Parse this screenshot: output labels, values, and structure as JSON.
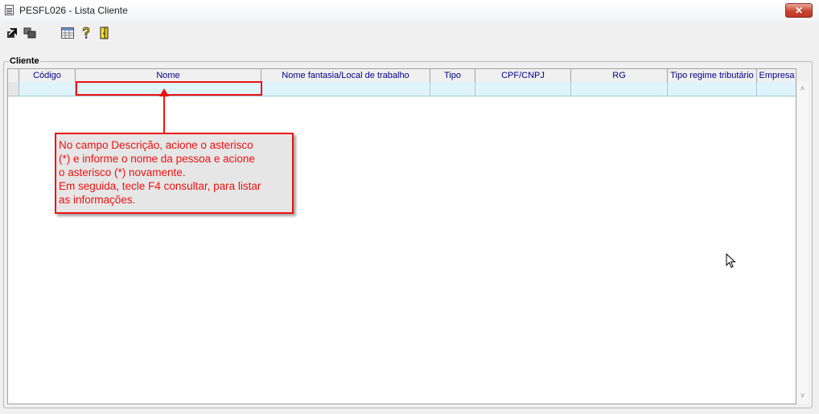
{
  "window": {
    "title": "PESFL026 - Lista Cliente",
    "close_label": "✕"
  },
  "toolbar": {
    "buttons": [
      {
        "icon": "export-arrow-icon"
      },
      {
        "icon": "windows-stack-icon"
      },
      {
        "icon": "grid-table-icon"
      },
      {
        "icon": "help-question-icon"
      },
      {
        "icon": "exit-door-icon"
      }
    ]
  },
  "group": {
    "label": "Cliente"
  },
  "grid": {
    "columns": [
      "",
      "Código",
      "Nome",
      "Nome fantasia/Local de trabalho",
      "Tipo",
      "CPF/CNPJ",
      "RG",
      "Tipo regime tributário",
      "Empresa"
    ]
  },
  "callout": {
    "text": "No campo Descrição, acione o asterisco\n(*) e informe o nome da pessoa e acione\no asterisco (*) novamente.\nEm seguida, tecle F4 consultar, para listar\nas informações.",
    "color": "#ee1111"
  },
  "scrollbar": {
    "up": "˄",
    "down": "˅"
  }
}
